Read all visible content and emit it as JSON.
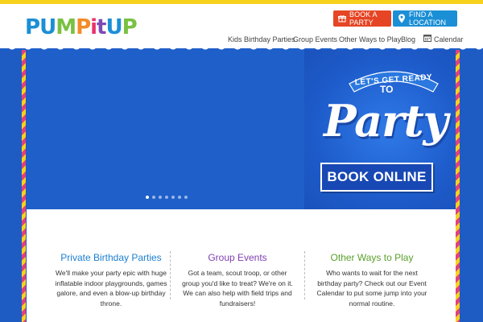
{
  "brand": {
    "logo_parts": [
      "P",
      "U",
      "M",
      "P",
      "i",
      "t",
      "U",
      "P"
    ],
    "logo_text": "PUMPitUP"
  },
  "header": {
    "book_party_label": "BOOK A PARTY",
    "find_location_label": "FIND A LOCATION",
    "book_party_icon": "gift-icon",
    "find_location_icon": "map-pin-icon"
  },
  "nav": {
    "items": [
      {
        "label": "Kids Birthday Parties"
      },
      {
        "label": "Group Events"
      },
      {
        "label": "Other Ways to Play"
      },
      {
        "label": "Blog"
      },
      {
        "label": "Calendar",
        "icon": "calendar-icon"
      }
    ]
  },
  "hero": {
    "ribbon_text": "LET'S GET READY",
    "to_text": "TO",
    "party_text": "Party",
    "cta_label": "BOOK ONLINE",
    "slides_count": 7,
    "active_slide": 1
  },
  "columns": [
    {
      "title": "Private Birthday Parties",
      "lines": [
        "We'll make your party epic with huge",
        "inflatable indoor playgrounds, games",
        "galore, and even a blow-up birthday",
        "throne."
      ]
    },
    {
      "title": "Group Events",
      "lines": [
        "Got a team, scout troop, or other",
        "group you'd like to treat? We're on it.",
        "We can also help with field trips and",
        "fundraisers!"
      ]
    },
    {
      "title": "Other Ways to Play",
      "lines": [
        "Who wants to wait for the next",
        "birthday party? Check out our Event",
        "Calendar to put some jump into your",
        "normal routine."
      ]
    }
  ],
  "colors": {
    "accent_yellow": "#f7d21d",
    "book_red": "#e54524",
    "find_blue": "#1b8fd6",
    "hero_blue": "#1f5fc9",
    "col1_blue": "#1b7fd1",
    "col2_purple": "#7d3fb0",
    "col3_green": "#5aa02c"
  }
}
